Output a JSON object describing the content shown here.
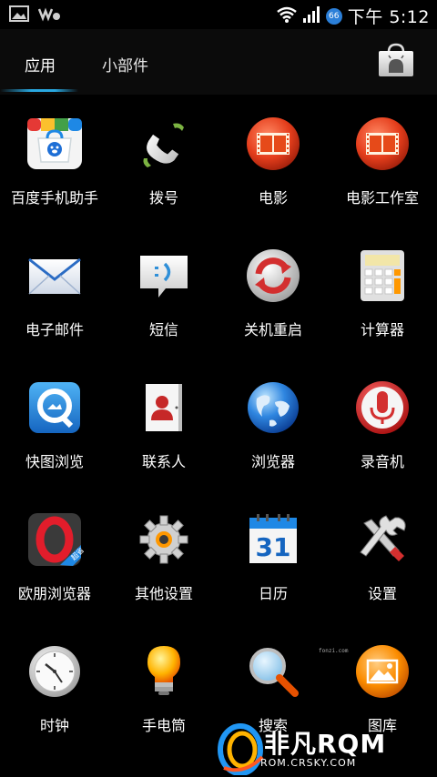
{
  "status_bar": {
    "time": "下午 5:12",
    "battery_badge": "66",
    "icons": [
      "gallery-icon",
      "walkman-icon",
      "wifi-icon",
      "signal-icon"
    ]
  },
  "tabs": {
    "apps_label": "应用",
    "widgets_label": "小部件",
    "active": "应用",
    "accent": "#29a8e0"
  },
  "apps": [
    {
      "label": "百度手机助手",
      "icon": "baidu-assistant-icon"
    },
    {
      "label": "拨号",
      "icon": "phone-icon"
    },
    {
      "label": "电影",
      "icon": "movie-icon"
    },
    {
      "label": "电影工作室",
      "icon": "movie-studio-icon"
    },
    {
      "label": "电子邮件",
      "icon": "email-icon"
    },
    {
      "label": "短信",
      "icon": "sms-icon"
    },
    {
      "label": "关机重启",
      "icon": "reboot-icon"
    },
    {
      "label": "计算器",
      "icon": "calculator-icon"
    },
    {
      "label": "快图浏览",
      "icon": "quickpic-icon"
    },
    {
      "label": "联系人",
      "icon": "contacts-icon"
    },
    {
      "label": "浏览器",
      "icon": "browser-globe-icon"
    },
    {
      "label": "录音机",
      "icon": "recorder-icon"
    },
    {
      "label": "欧朋浏览器",
      "icon": "opera-icon"
    },
    {
      "label": "其他设置",
      "icon": "other-settings-gear-icon"
    },
    {
      "label": "日历",
      "icon": "calendar-icon"
    },
    {
      "label": "设置",
      "icon": "settings-tools-icon"
    },
    {
      "label": "时钟",
      "icon": "clock-icon"
    },
    {
      "label": "手电筒",
      "icon": "flashlight-icon"
    },
    {
      "label": "搜索",
      "icon": "search-icon"
    },
    {
      "label": "图库",
      "icon": "gallery-app-icon"
    }
  ],
  "calendar_day": "31",
  "opera_badge": "超省",
  "watermark": {
    "big": "非凡RQM",
    "small": "ROM.CRSKY.COM",
    "tiny": "fonzi.com"
  }
}
